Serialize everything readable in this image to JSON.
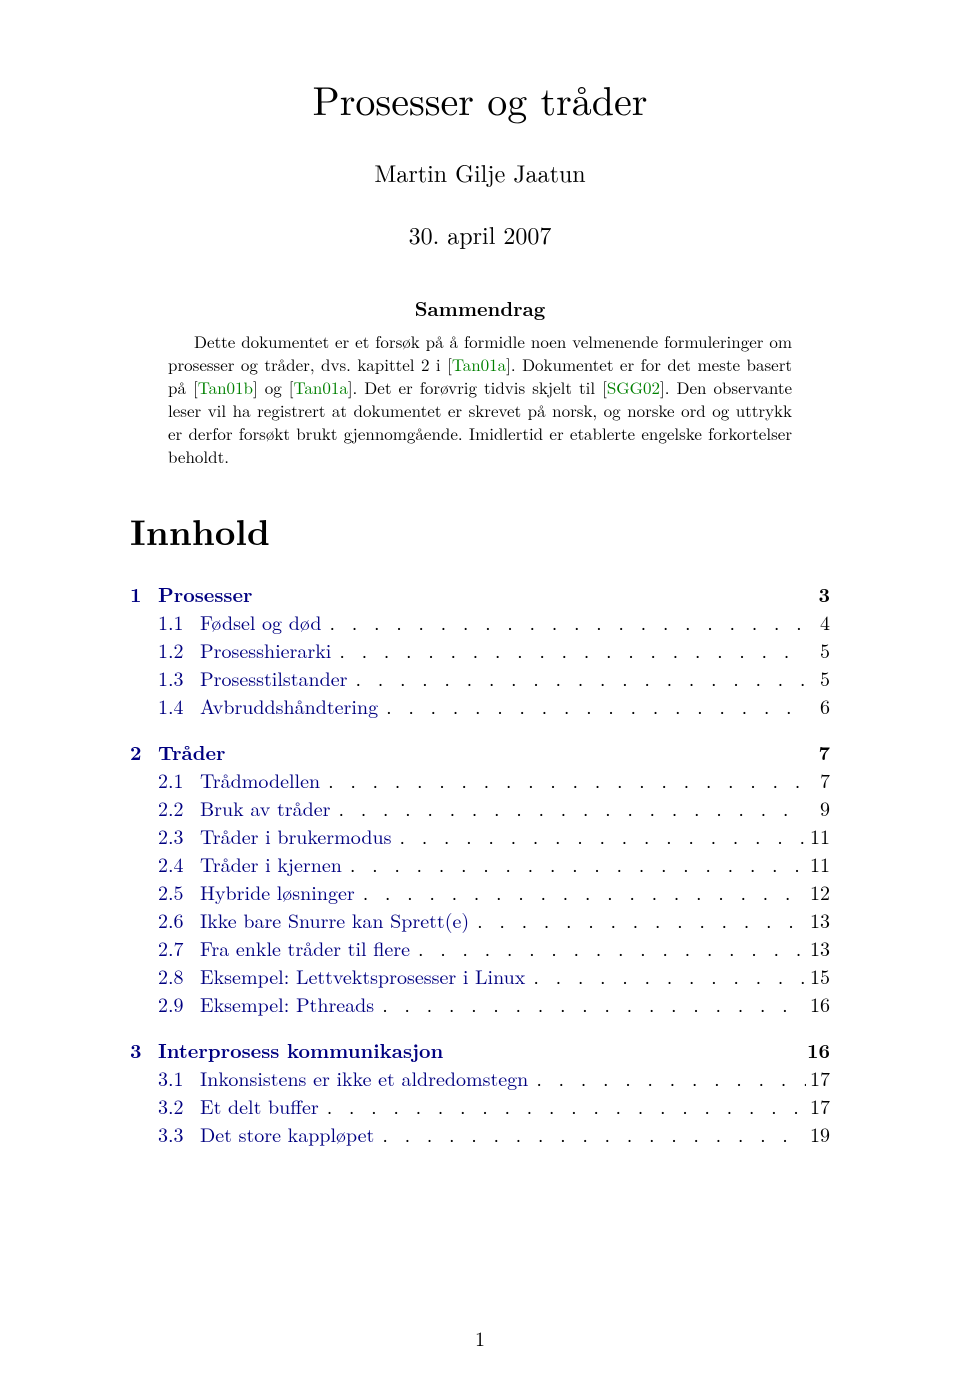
{
  "title": "Prosesser og tråder",
  "author": "Martin Gilje Jaatun",
  "date": "30. april 2007",
  "abstract": {
    "header": "Sammendrag",
    "p1a": "Dette dokumentet er et forsøk på å formidle noen velmenende formuleringer om prosesser og tråder, dvs. kapittel 2 i [",
    "c1": "Tan01a",
    "p1b": "]. Dokumentet er for det meste basert på [",
    "c2": "Tan01b",
    "p1c": "] og [",
    "c3": "Tan01a",
    "p1d": "]. Det er forøvrig tidvis skjelt til [",
    "c4": "SGG02",
    "p1e": "].",
    "p2": "Den observante leser vil ha registrert at dokumentet er skrevet på norsk, og norske ord og uttrykk er derfor forsøkt brukt gjennomgående. Imidlertid er etablerte engelske forkortelser beholdt."
  },
  "toc": {
    "title": "Innhold",
    "sections": [
      {
        "num": "1",
        "label": "Prosesser",
        "page": "3",
        "subs": [
          {
            "num": "1.1",
            "label": "Fødsel og død",
            "page": "4"
          },
          {
            "num": "1.2",
            "label": "Prosesshierarki",
            "page": "5"
          },
          {
            "num": "1.3",
            "label": "Prosesstilstander",
            "page": "5"
          },
          {
            "num": "1.4",
            "label": "Avbruddshåndtering",
            "page": "6"
          }
        ]
      },
      {
        "num": "2",
        "label": "Tråder",
        "page": "7",
        "subs": [
          {
            "num": "2.1",
            "label": "Trådmodellen",
            "page": "7"
          },
          {
            "num": "2.2",
            "label": "Bruk av tråder",
            "page": "9"
          },
          {
            "num": "2.3",
            "label": "Tråder i brukermodus",
            "page": "11"
          },
          {
            "num": "2.4",
            "label": "Tråder i kjernen",
            "page": "11"
          },
          {
            "num": "2.5",
            "label": "Hybride løsninger",
            "page": "12"
          },
          {
            "num": "2.6",
            "label": "Ikke bare Snurre kan Sprett(e)",
            "page": "13"
          },
          {
            "num": "2.7",
            "label": "Fra enkle tråder til flere",
            "page": "13"
          },
          {
            "num": "2.8",
            "label": "Eksempel: Lettvektsprosesser i Linux",
            "page": "15"
          },
          {
            "num": "2.9",
            "label": "Eksempel: Pthreads",
            "page": "16"
          }
        ]
      },
      {
        "num": "3",
        "label": "Interprosess kommunikasjon",
        "page": "16",
        "subs": [
          {
            "num": "3.1",
            "label": "Inkonsistens er ikke et aldredomstegn",
            "page": "17"
          },
          {
            "num": "3.2",
            "label": "Et delt buffer",
            "page": "17"
          },
          {
            "num": "3.3",
            "label": "Det store kappløpet",
            "page": "19"
          }
        ]
      }
    ]
  },
  "pageNumber": "1"
}
